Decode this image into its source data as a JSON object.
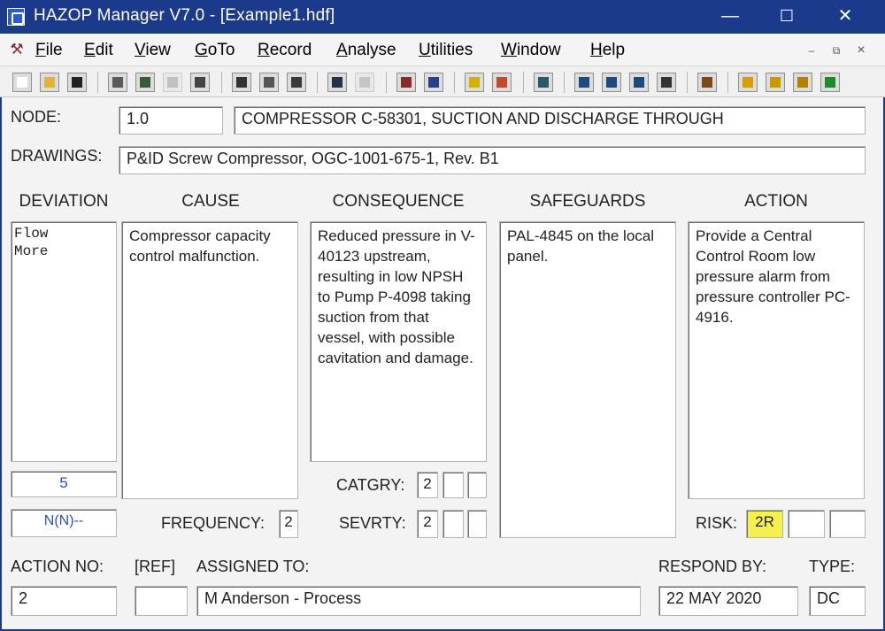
{
  "window": {
    "title": "HAZOP Manager V7.0 - [Example1.hdf]",
    "minimize": "—",
    "maximize": "☐",
    "close": "✕"
  },
  "menu": {
    "items": [
      {
        "label": "File"
      },
      {
        "label": "Edit"
      },
      {
        "label": "View"
      },
      {
        "label": "GoTo"
      },
      {
        "label": "Record"
      },
      {
        "label": "Analyse"
      },
      {
        "label": "Utilities"
      },
      {
        "label": "Window"
      },
      {
        "label": "Help"
      }
    ],
    "mdi_minimize": "–",
    "mdi_restore": "⧉",
    "mdi_close": "×"
  },
  "toolbar": {
    "icons": [
      "new-file-icon",
      "open-folder-icon",
      "save-icon",
      "record-list-icon",
      "transfer-icon",
      "grid-icon",
      "edit-chart-icon",
      "cut-icon",
      "copy-icon",
      "paste-icon",
      "worksheet-icon",
      "checklist-icon",
      "find-icon",
      "spell-check-icon",
      "report-icon",
      "chart-icon",
      "preview-icon",
      "view1-icon",
      "view2-icon",
      "view3-icon",
      "binoculars-icon",
      "settings-icon",
      "export-icon",
      "table-icon",
      "print-icon",
      "excel-icon"
    ]
  },
  "record": {
    "node_label": "NODE:",
    "node_number": "1.0",
    "node_description": "COMPRESSOR C-58301, SUCTION AND DISCHARGE THROUGH",
    "drawings_label": "DRAWINGS:",
    "drawings_value": "P&ID Screw Compressor, OGC-1001-675-1, Rev. B1"
  },
  "columns": {
    "deviation": "DEVIATION",
    "cause": "CAUSE",
    "consequence": "CONSEQUENCE",
    "safeguards": "SAFEGUARDS",
    "action": "ACTION"
  },
  "worksheet": {
    "deviation_lines": [
      "Flow",
      "More"
    ],
    "deviation_number": "5",
    "deviation_code": "N(N)--",
    "cause": "Compressor capacity control malfunction.",
    "consequence": "Reduced pressure in V-40123 upstream, resulting in low NPSH to Pump P-4098 taking suction from that vessel, with possible cavitation and damage.",
    "safeguards": "PAL-4845 on the local panel.",
    "action": "Provide a Central Control Room low pressure alarm from pressure controller PC-4916.",
    "catgry_label": "CATGRY:",
    "catgry_values": [
      "2",
      "",
      ""
    ],
    "frequency_label": "FREQUENCY:",
    "frequency_value": "2",
    "sevrty_label": "SEVRTY:",
    "sevrty_values": [
      "2",
      "",
      ""
    ],
    "risk_label": "RISK:",
    "risk_values": [
      "2R",
      "",
      ""
    ]
  },
  "action_info": {
    "action_no_label": "ACTION NO:",
    "action_no_value": "2",
    "ref_label": "[REF]",
    "ref_value": "",
    "assigned_label": "ASSIGNED TO:",
    "assigned_value": "M Anderson - Process",
    "respond_label": "RESPOND BY:",
    "respond_value": "22 MAY 2020",
    "type_label": "TYPE:",
    "type_value": "DC"
  },
  "colors": {
    "titlebar": "#1b3a8c",
    "risk_highlight": "#f6f04c",
    "code_text": "#2d4fc9"
  }
}
